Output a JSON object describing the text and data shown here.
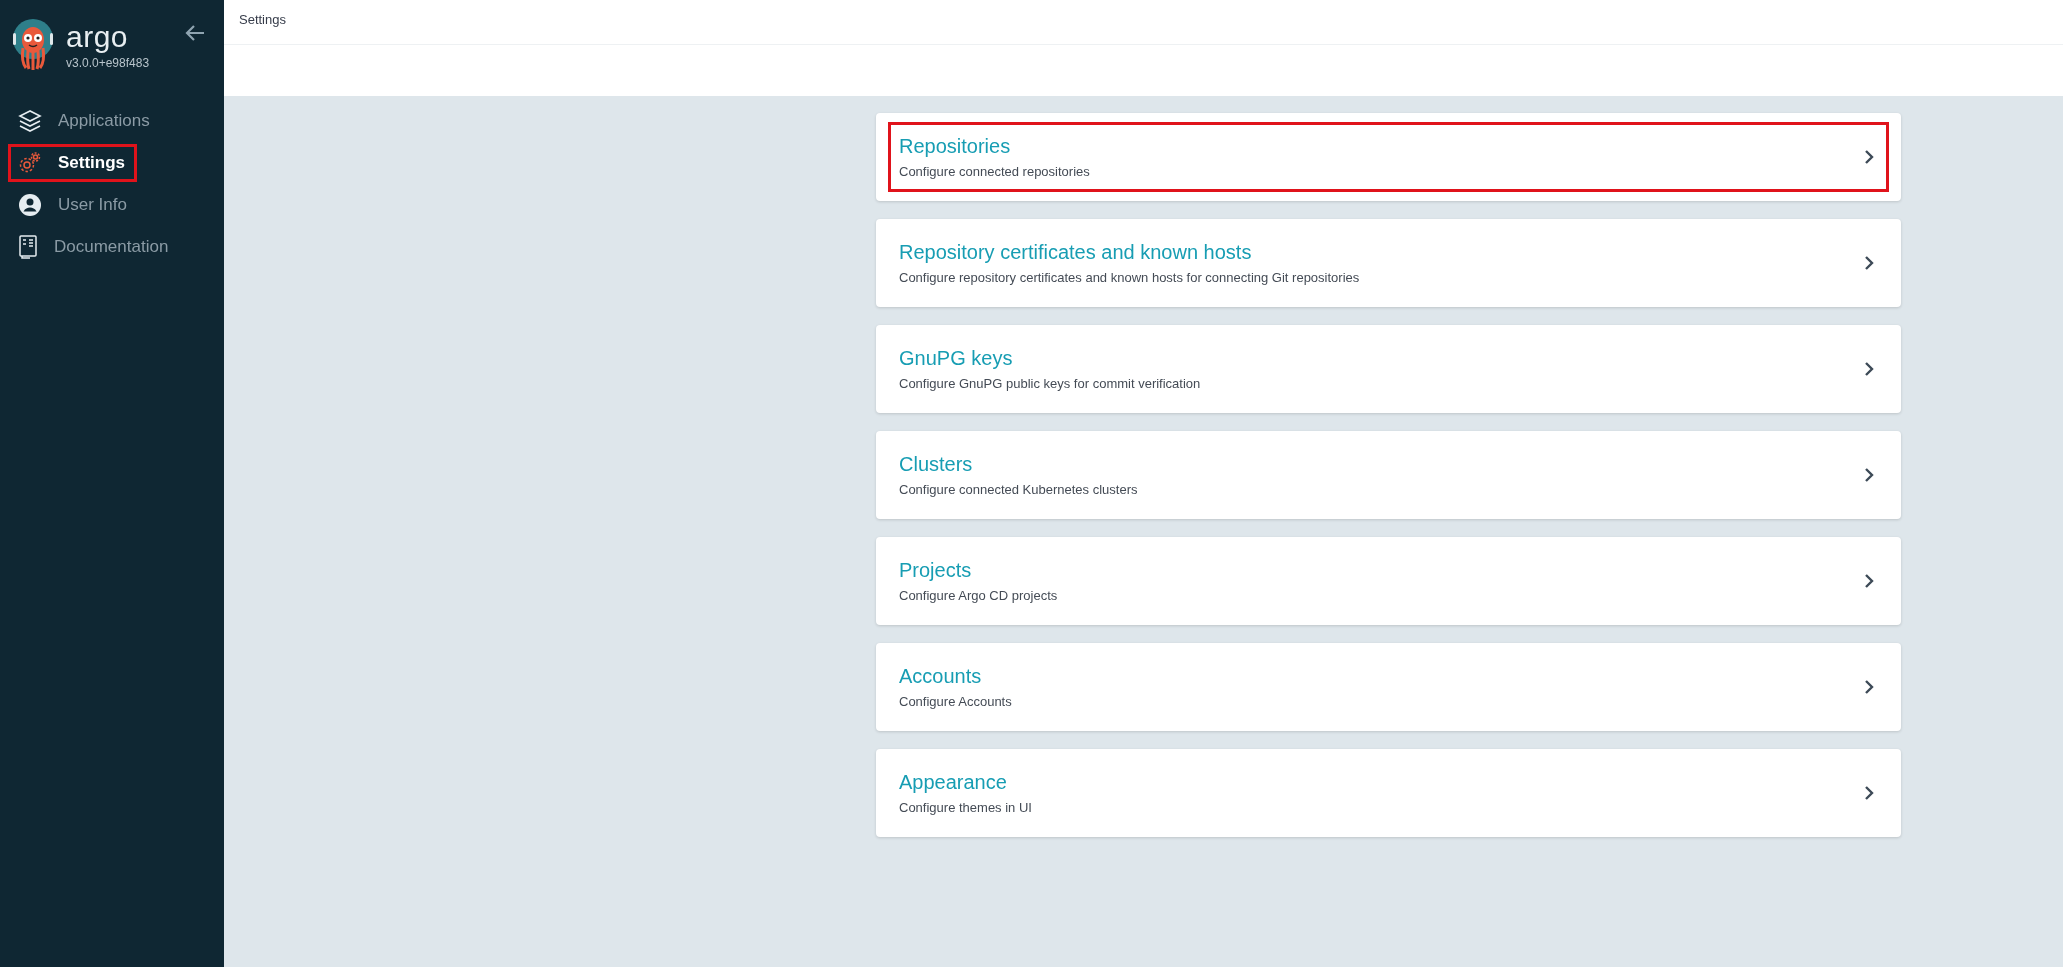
{
  "sidebar": {
    "brand": "argo",
    "version": "v3.0.0+e98f483",
    "items": [
      {
        "kind": "applications",
        "label": "Applications",
        "selected": false,
        "highlighted": false
      },
      {
        "kind": "settings",
        "label": "Settings",
        "selected": true,
        "highlighted": true
      },
      {
        "kind": "user",
        "label": "User Info",
        "selected": false,
        "highlighted": false
      },
      {
        "kind": "docs",
        "label": "Documentation",
        "selected": false,
        "highlighted": false
      }
    ]
  },
  "header": {
    "title": "Settings"
  },
  "cards": [
    {
      "title": "Repositories",
      "description": "Configure connected repositories",
      "highlighted": true
    },
    {
      "title": "Repository certificates and known hosts",
      "description": "Configure repository certificates and known hosts for connecting Git repositories",
      "highlighted": false
    },
    {
      "title": "GnuPG keys",
      "description": "Configure GnuPG public keys for commit verification",
      "highlighted": false
    },
    {
      "title": "Clusters",
      "description": "Configure connected Kubernetes clusters",
      "highlighted": false
    },
    {
      "title": "Projects",
      "description": "Configure Argo CD projects",
      "highlighted": false
    },
    {
      "title": "Accounts",
      "description": "Configure Accounts",
      "highlighted": false
    },
    {
      "title": "Appearance",
      "description": "Configure themes in UI",
      "highlighted": false
    }
  ]
}
